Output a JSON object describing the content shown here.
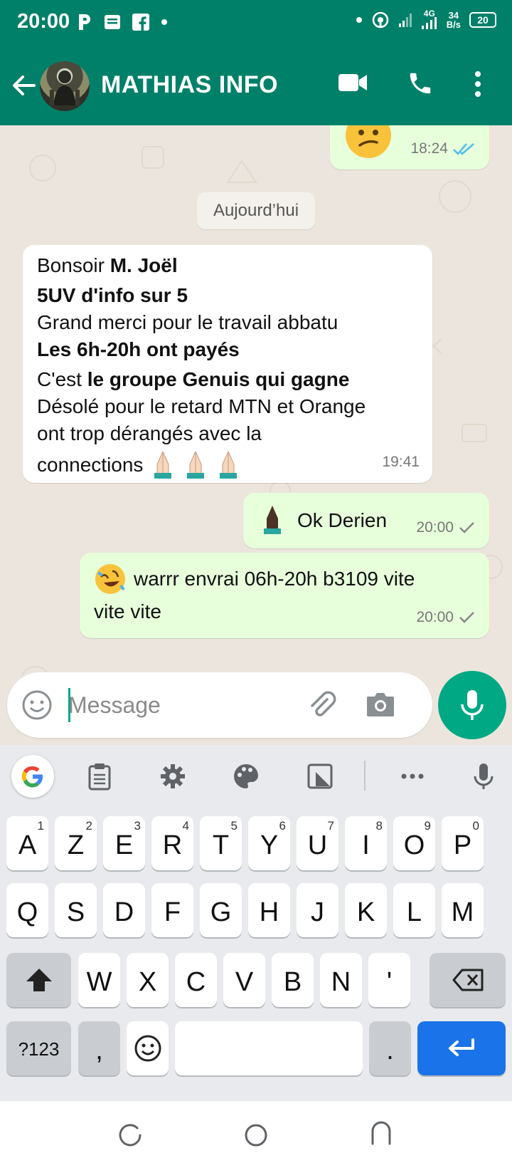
{
  "status_bar": {
    "time": "20:00",
    "network": "4G",
    "speed_value": "34",
    "speed_unit": "B/s",
    "battery": "20"
  },
  "header": {
    "contact_name": "MATHIAS INFO"
  },
  "chat": {
    "prev_time": "18:24",
    "date_divider": "Aujourd’hui",
    "incoming": {
      "lines": [
        {
          "normal": "Bonsoir ",
          "bold": "M. Joël"
        },
        {
          "bold": "5UV d'info sur 5"
        },
        {
          "normal": "Grand merci pour le travail abbatu"
        },
        {
          "bold": "Les 6h-20h ont payés"
        },
        {
          "normal": "C'est ",
          "bold": "le groupe Genuis qui gagne"
        },
        {
          "normal": "Désolé pour le retard MTN et Orange"
        },
        {
          "normal": "ont trop dérangés avec la"
        },
        {
          "normal": "connections"
        }
      ],
      "time": "19:41"
    },
    "outgoing_1": {
      "text": "Ok Derien",
      "time": "20:00"
    },
    "outgoing_2": {
      "text_line1": "warrr envrai 06h-20h b3109 vite",
      "text_line2": "vite vite",
      "time": "20:00"
    }
  },
  "input": {
    "placeholder": "Message"
  },
  "keyboard": {
    "row1": [
      {
        "k": "A",
        "n": "1"
      },
      {
        "k": "Z",
        "n": "2"
      },
      {
        "k": "E",
        "n": "3"
      },
      {
        "k": "R",
        "n": "4"
      },
      {
        "k": "T",
        "n": "5"
      },
      {
        "k": "Y",
        "n": "6"
      },
      {
        "k": "U",
        "n": "7"
      },
      {
        "k": "I",
        "n": "8"
      },
      {
        "k": "O",
        "n": "9"
      },
      {
        "k": "P",
        "n": "0"
      }
    ],
    "row2": [
      "Q",
      "S",
      "D",
      "F",
      "G",
      "H",
      "J",
      "K",
      "L",
      "M"
    ],
    "row3": [
      "W",
      "X",
      "C",
      "V",
      "B",
      "N",
      "'"
    ],
    "symbols_key": "?123",
    "comma_key": ",",
    "period_key": "."
  },
  "colors": {
    "header": "#008069",
    "accent": "#00a884",
    "outgoing_bubble": "#e7ffdb",
    "read_ticks": "#53bdeb",
    "enter_key": "#1a73e8"
  }
}
